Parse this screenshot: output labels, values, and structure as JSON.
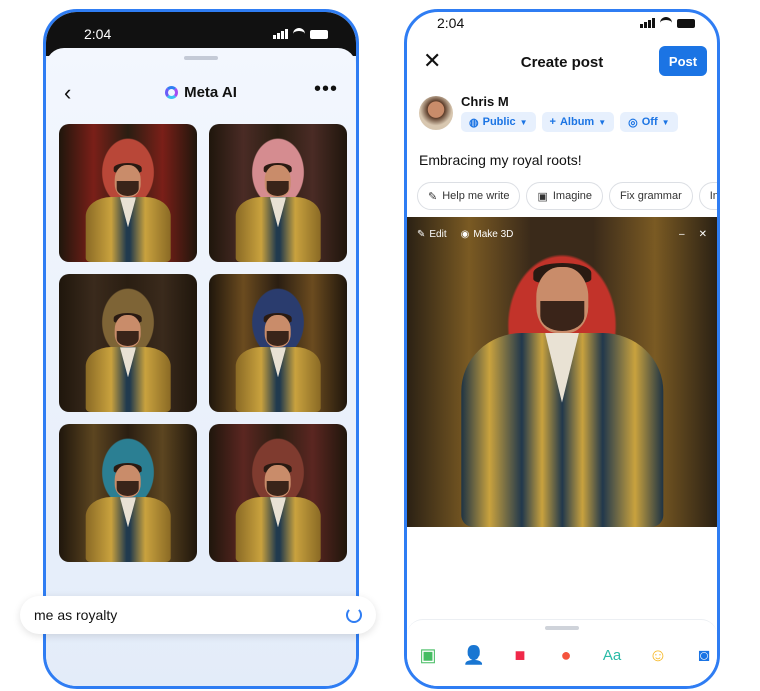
{
  "left_phone": {
    "status_time": "2:04",
    "header_title": "Meta AI",
    "back_icon": "chevron-left-icon",
    "more_icon": "more-dots-icon",
    "images": [
      {
        "bg": "#7a1f18",
        "accent": "#b94738"
      },
      {
        "bg": "#4a2b25",
        "accent": "#d58c90"
      },
      {
        "bg": "#3a2a1c",
        "accent": "#7e6436"
      },
      {
        "bg": "#6b4b1f",
        "accent": "#2a3c6e"
      },
      {
        "bg": "#5c4520",
        "accent": "#2b7f93"
      },
      {
        "bg": "#5b2621",
        "accent": "#7f3b2f"
      }
    ],
    "prompt_text": "me as royalty",
    "regenerate_icon": "refresh-icon"
  },
  "right_phone": {
    "status_time": "2:04",
    "close_icon": "close-icon",
    "title": "Create post",
    "post_button": "Post",
    "author_name": "Chris M",
    "audience_pills": [
      {
        "icon": "globe-icon",
        "label": "Public"
      },
      {
        "icon": "plus-icon",
        "label": "Album"
      },
      {
        "icon": "instagram-icon",
        "label": "Off"
      }
    ],
    "post_text": "Embracing my royal roots!",
    "ai_tools": [
      {
        "icon": "pen-icon",
        "label": "Help me write"
      },
      {
        "icon": "image-icon",
        "label": "Imagine"
      },
      {
        "icon": "",
        "label": "Fix grammar"
      },
      {
        "icon": "",
        "label": "In"
      }
    ],
    "image_bar": {
      "edit": "Edit",
      "make3d": "Make 3D"
    },
    "compose_icons": [
      "photo-icon",
      "tag-people-icon",
      "live-video-icon",
      "location-icon",
      "text-style-icon",
      "feeling-icon",
      "camera-icon"
    ],
    "compose_text_style": "Aa"
  },
  "colors": {
    "accent_blue": "#1b74e4",
    "frame_blue": "#2f7df3"
  }
}
